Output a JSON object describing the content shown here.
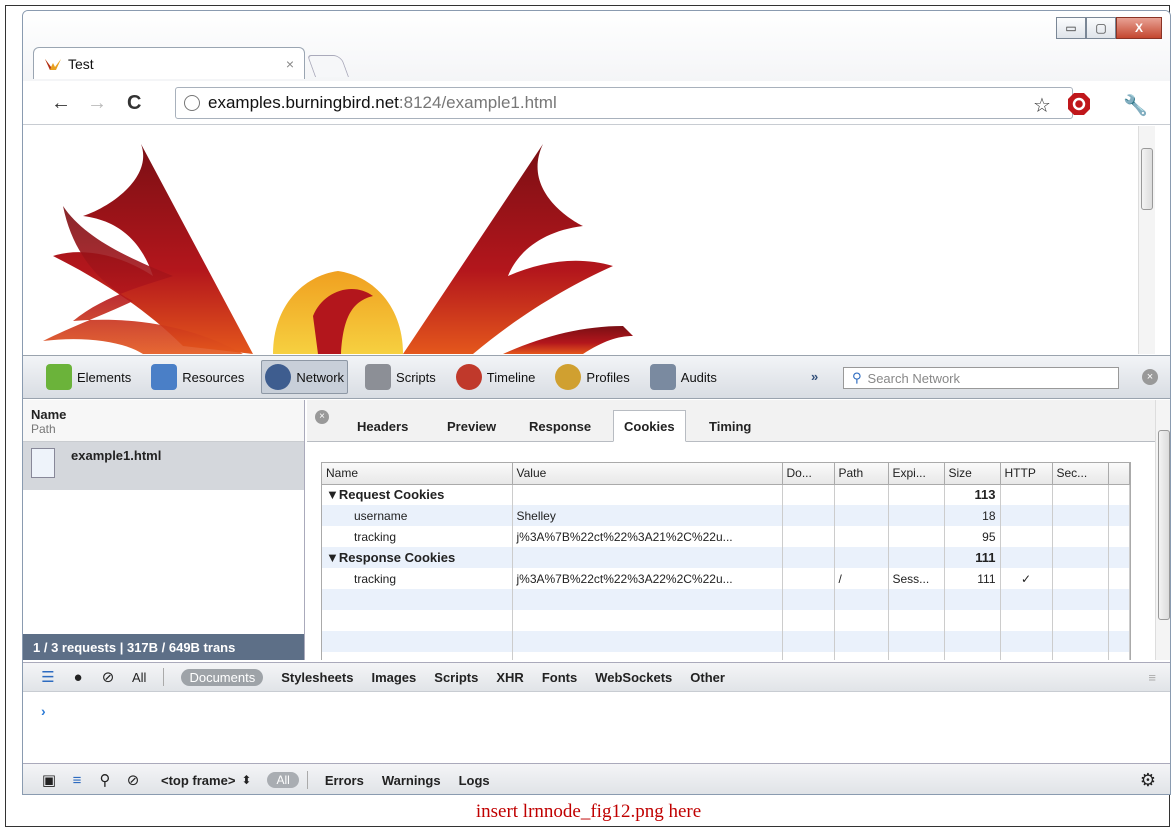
{
  "browser": {
    "tab_title": "Test",
    "tab_close": "×",
    "window_controls": {
      "minimize": "▭",
      "maximize": "▢",
      "close": "X"
    },
    "nav": {
      "back": "←",
      "forward": "→",
      "reload": "C"
    },
    "url_host": "examples.burningbird.net",
    "url_rest": ":8124/example1.html",
    "star": "☆",
    "wrench": "🔧"
  },
  "devtools": {
    "panels": [
      {
        "label": "Elements",
        "color": "#6bb33a"
      },
      {
        "label": "Resources",
        "color": "#4a7fc7"
      },
      {
        "label": "Network",
        "color": "#3e5d8f"
      },
      {
        "label": "Scripts",
        "color": "#8c8f96"
      },
      {
        "label": "Timeline",
        "color": "#c0392b"
      },
      {
        "label": "Profiles",
        "color": "#d0a030"
      },
      {
        "label": "Audits",
        "color": "#7a8aa0"
      }
    ],
    "more": "»",
    "search_placeholder": "Search Network",
    "request_list": {
      "name_header": "Name",
      "path_header": "Path",
      "request_name": "example1.html",
      "status": "1 / 3 requests   |   317B / 649B trans"
    },
    "detail_tabs": [
      "Headers",
      "Preview",
      "Response",
      "Cookies",
      "Timing"
    ],
    "active_detail_tab": "Cookies",
    "cookie_table": {
      "headers": [
        "Name",
        "Value",
        "Do...",
        "Path",
        "Expi...",
        "Size",
        "HTTP",
        "Sec..."
      ],
      "request_group": {
        "label": "▼Request Cookies",
        "size": "113"
      },
      "request_rows": [
        {
          "name": "username",
          "value": "Shelley",
          "size": "18"
        },
        {
          "name": "tracking",
          "value": "j%3A%7B%22ct%22%3A21%2C%22u...",
          "size": "95"
        }
      ],
      "response_group": {
        "label": "▼Response Cookies",
        "size": "111"
      },
      "response_rows": [
        {
          "name": "tracking",
          "value": "j%3A%7B%22ct%22%3A22%2C%22u...",
          "path": "/",
          "expires": "Sess...",
          "size": "111",
          "http": "✓"
        }
      ]
    },
    "console_filters": [
      "All",
      "Documents",
      "Stylesheets",
      "Images",
      "Scripts",
      "XHR",
      "Fonts",
      "WebSockets",
      "Other"
    ],
    "selected_filter": "Documents",
    "prompt": "›",
    "bottom": {
      "frame": "<top frame>",
      "frame_arrows": "⬍",
      "all_pill": "All",
      "levels": [
        "Errors",
        "Warnings",
        "Logs"
      ]
    }
  },
  "caption": "insert lrnnode_fig12.png here"
}
